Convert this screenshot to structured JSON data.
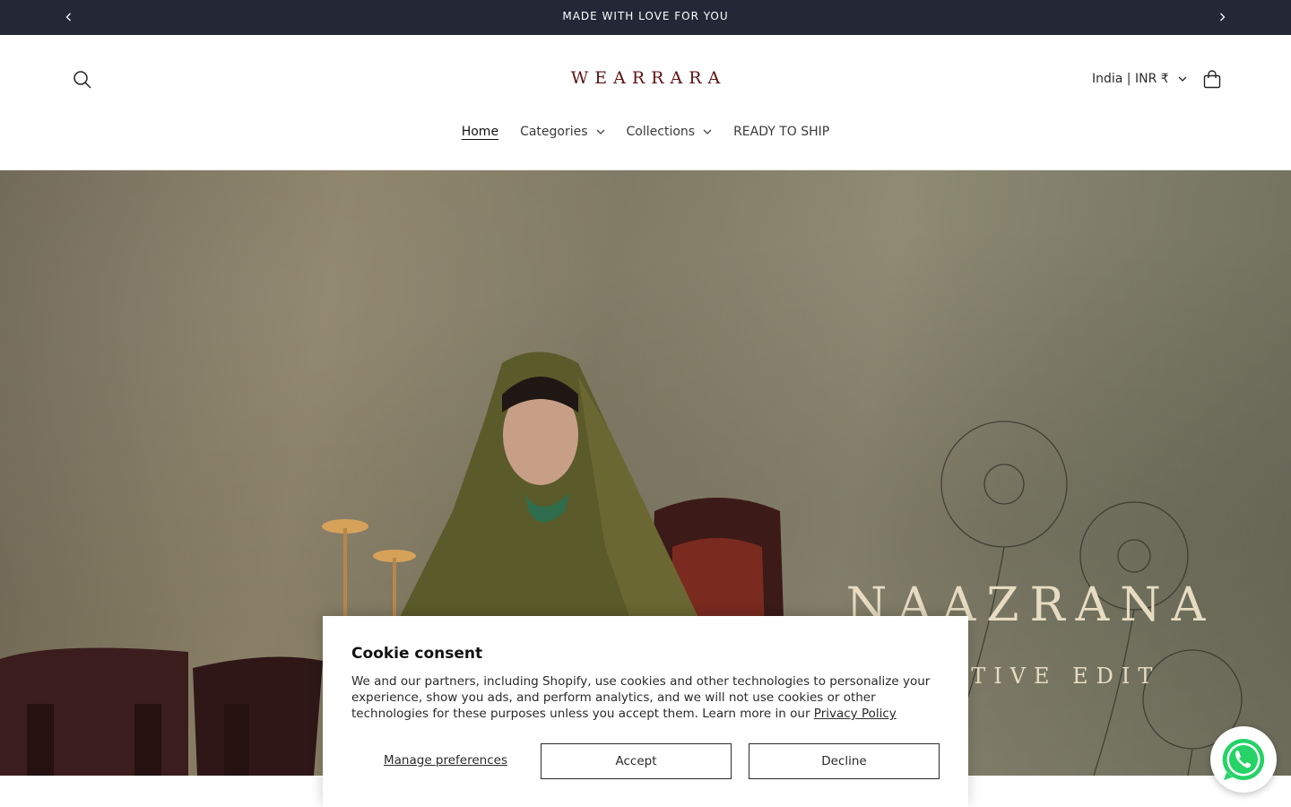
{
  "announcement": {
    "message": "MADE WITH LOVE FOR YOU",
    "prev_icon": "chevron-left-icon",
    "next_icon": "chevron-right-icon"
  },
  "header": {
    "logo_text": "WEARRARA",
    "search_icon": "search-icon",
    "locale_label": "India | INR ₹",
    "cart_icon": "shopping-bag-icon",
    "brand_color": "#5e1414"
  },
  "nav": {
    "items": [
      {
        "label": "Home",
        "active": true,
        "has_dropdown": false
      },
      {
        "label": "Categories",
        "active": false,
        "has_dropdown": true
      },
      {
        "label": "Collections",
        "active": false,
        "has_dropdown": true
      },
      {
        "label": "READY TO SHIP",
        "active": false,
        "has_dropdown": false
      }
    ]
  },
  "hero": {
    "title": "NAAZRANA",
    "subtitle": "FESTIVE EDIT"
  },
  "cookie": {
    "title": "Cookie consent",
    "body": "We and our partners, including Shopify, use cookies and other technologies to personalize your experience, show you ads, and perform analytics, and we will not use cookies or other technologies for these purposes unless you accept them. Learn more in our ",
    "link_text": "Privacy Policy",
    "manage_label": "Manage preferences",
    "accept_label": "Accept",
    "decline_label": "Decline"
  },
  "whatsapp": {
    "icon": "whatsapp-icon",
    "color": "#25d366"
  },
  "colors": {
    "announcement_bg": "#232736",
    "hero_text": "#e7dcc2"
  }
}
